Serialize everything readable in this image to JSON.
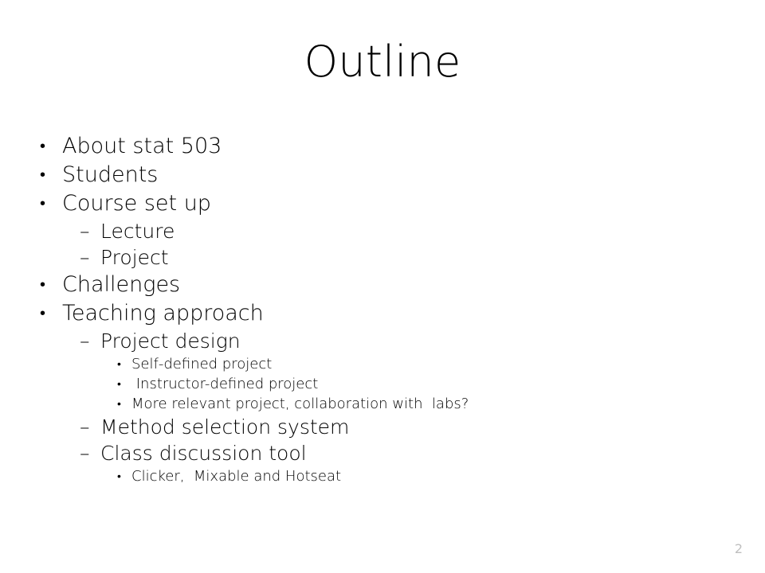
{
  "slide": {
    "title": "Outline",
    "page_number": "2",
    "background_color": "#ffffff",
    "text_color": "#000000",
    "page_number_color": "#bfbfbf"
  },
  "markers": {
    "level1": "•",
    "level2": "–",
    "level3": "•"
  },
  "outline": [
    {
      "level": 1,
      "text": "About stat 503"
    },
    {
      "level": 1,
      "text": "Students"
    },
    {
      "level": 1,
      "text": "Course set up"
    },
    {
      "level": 2,
      "text": "Lecture"
    },
    {
      "level": 2,
      "text": "Project"
    },
    {
      "level": 1,
      "text": "Challenges"
    },
    {
      "level": 1,
      "text": "Teaching approach"
    },
    {
      "level": 2,
      "text": "Project design"
    },
    {
      "level": 3,
      "text": "Self-defined project"
    },
    {
      "level": 3,
      "text": " Instructor-defined project"
    },
    {
      "level": 3,
      "text": "More relevant project, collaboration with  labs?"
    },
    {
      "level": 2,
      "text": "Method selection system"
    },
    {
      "level": 2,
      "text": "Class discussion tool"
    },
    {
      "level": 3,
      "text": "Clicker,  Mixable and Hotseat"
    }
  ]
}
